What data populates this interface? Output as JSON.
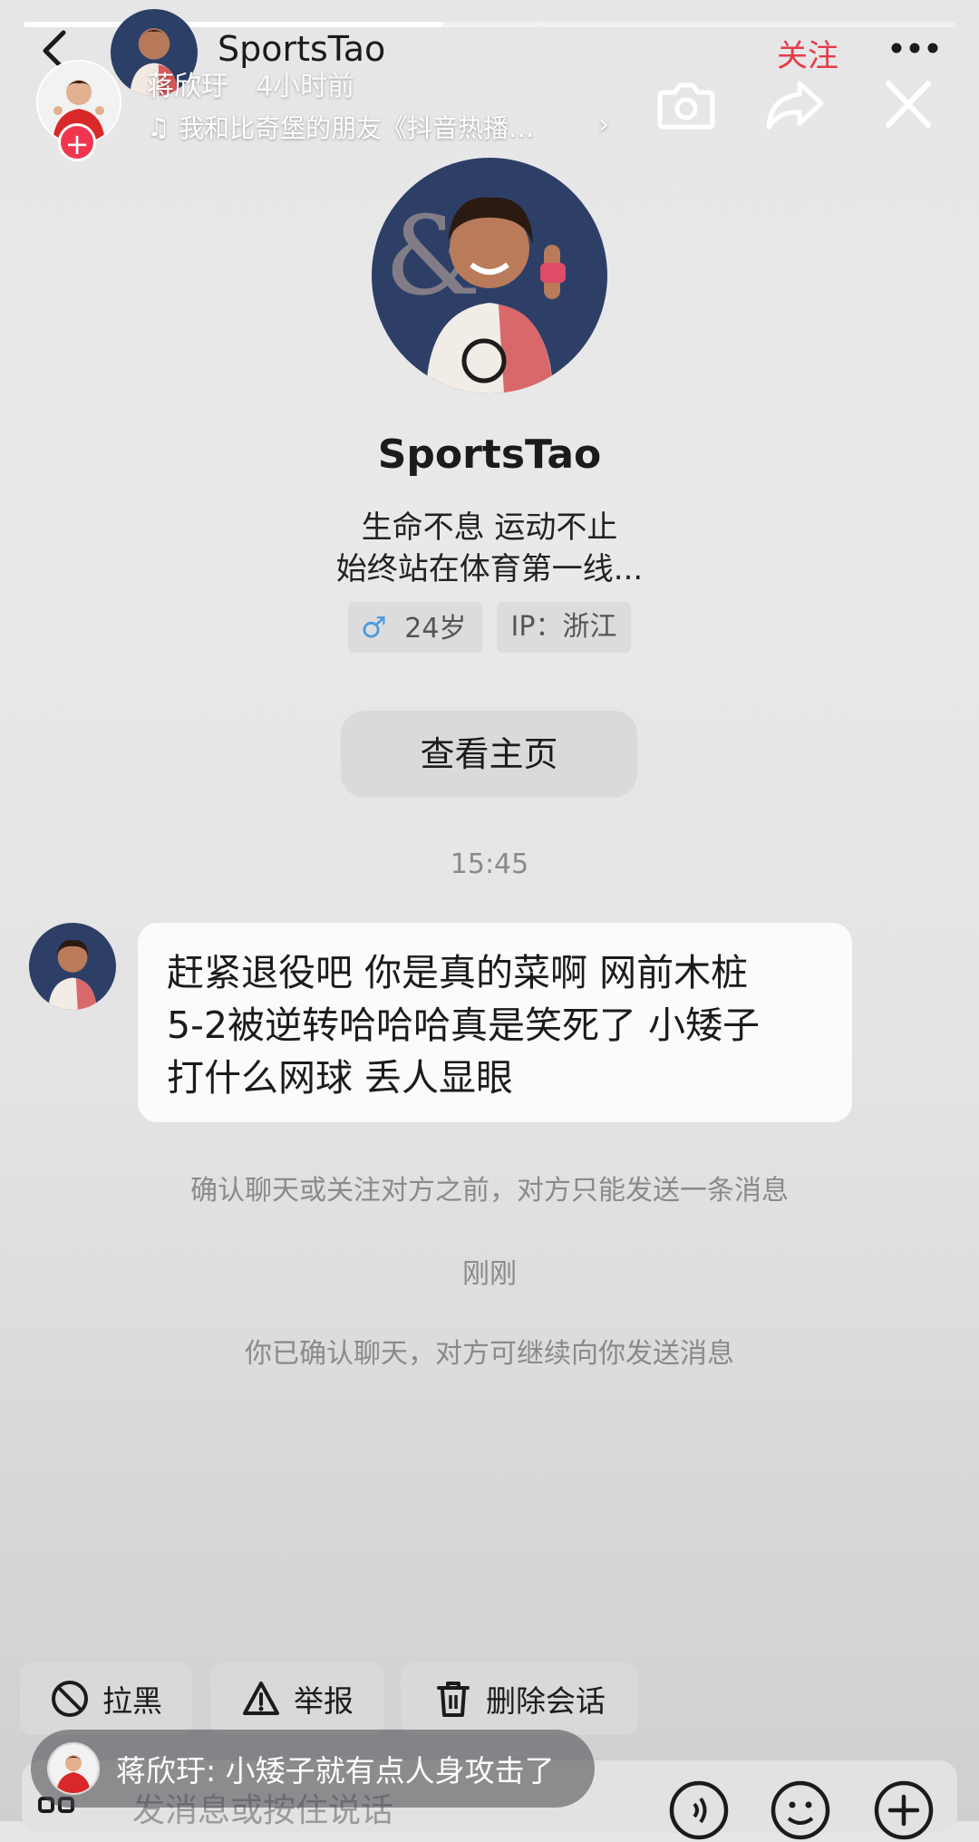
{
  "story": {
    "progress": 0.45,
    "username": "蒋欣玗",
    "time_ago": "4小时前",
    "music": "我和比奇堡的朋友《抖音热播…",
    "icons": [
      "camera-icon",
      "share-icon",
      "close-icon"
    ]
  },
  "header": {
    "title": "SportsTao",
    "follow_label": "关注"
  },
  "profile": {
    "name": "SportsTao",
    "bio_line1": "生命不息 运动不止",
    "bio_line2": "始终站在体育第一线...",
    "gender_age": "24岁",
    "ip": "IP：浙江",
    "homepage_label": "查看主页"
  },
  "chat": {
    "time": "15:45",
    "message_lines": [
      "赶紧退役吧 你是真的菜啊 网前木桩",
      "5-2被逆转哈哈哈真是笑死了 小矮子",
      "打什么网球 丢人显眼"
    ],
    "notice1": "确认聊天或关注对方之前，对方只能发送一条消息",
    "time2": "刚刚",
    "notice2": "你已确认聊天，对方可继续向你发送消息"
  },
  "actions": {
    "block": "拉黑",
    "report": "举报",
    "delete": "删除会话"
  },
  "input": {
    "placeholder": "发消息或按住说话"
  },
  "toast": {
    "text": "蒋欣玗: 小矮子就有点人身攻击了"
  },
  "colors": {
    "accent_red": "#e43b4a",
    "badge_red": "#f0364f",
    "male_blue": "#4a9be0"
  }
}
